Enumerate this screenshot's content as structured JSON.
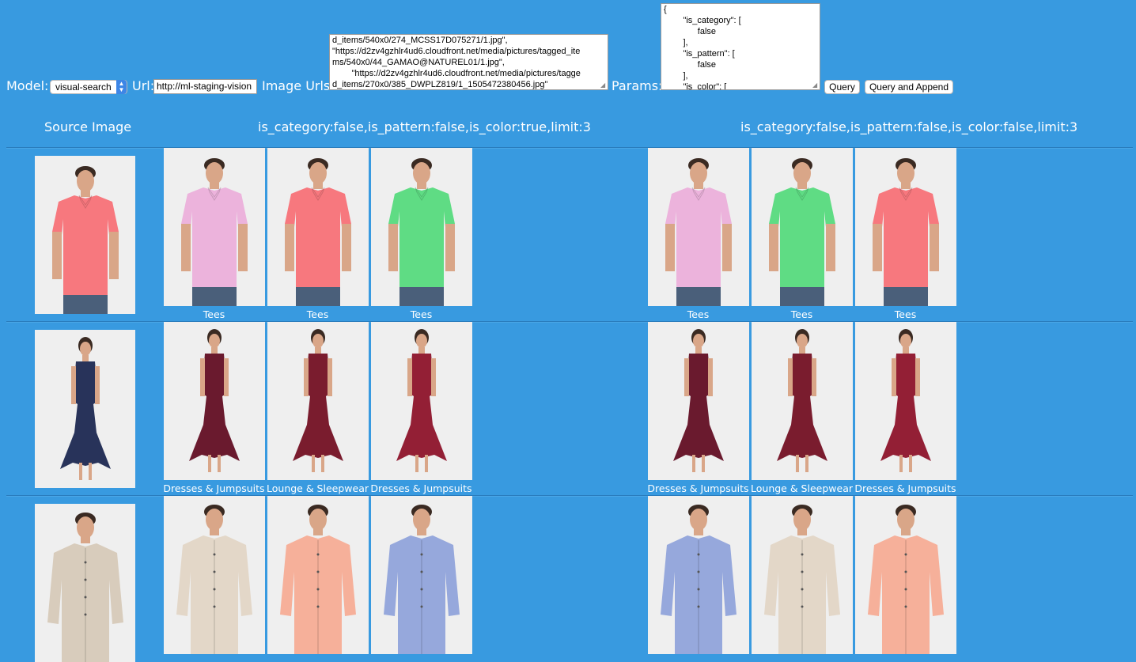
{
  "toolbar": {
    "model_label": "Model:",
    "model_value": "visual-search",
    "url_label": "Url:",
    "url_value": "http://ml-staging-vision",
    "image_urls_label": "Image Urls:",
    "image_urls_value": "d_items/540x0/274_MCSS17D075271/1.jpg\",\n\"https://d2zv4gzhlr4ud6.cloudfront.net/media/pictures/tagged_ite\nms/540x0/44_GAMAO@NATUREL01/1.jpg\",\n        \"https://d2zv4gzhlr4ud6.cloudfront.net/media/pictures/tagge\nd_items/270x0/385_DWPLZ819/1_1505472380456.jpg\"",
    "params_label": "Params:",
    "params_value": "{\n        \"is_category\": [\n              false\n        ],\n        \"is_pattern\": [\n              false\n        ],\n        \"is_color\": [",
    "query_button": "Query",
    "query_append_button": "Query and Append"
  },
  "headers": {
    "source": "Source Image",
    "col1": "is_category:false,is_pattern:false,is_color:true,limit:3",
    "col2": "is_category:false,is_pattern:false,is_color:false,limit:3"
  },
  "rows": [
    {
      "source": {
        "type": "tee",
        "color": "#f7787e"
      },
      "col1": [
        {
          "type": "tee",
          "color": "#ecb3dc",
          "label": "Tees"
        },
        {
          "type": "tee",
          "color": "#f7787e",
          "label": "Tees"
        },
        {
          "type": "tee",
          "color": "#5fdc84",
          "label": "Tees"
        }
      ],
      "col2": [
        {
          "type": "tee",
          "color": "#ecb3dc",
          "label": "Tees"
        },
        {
          "type": "tee",
          "color": "#5fdc84",
          "label": "Tees"
        },
        {
          "type": "tee",
          "color": "#f7787e",
          "label": "Tees"
        }
      ]
    },
    {
      "source": {
        "type": "dress",
        "color": "#28335a"
      },
      "col1": [
        {
          "type": "dress",
          "color": "#6a1a2e",
          "label": "Dresses & Jumpsuits"
        },
        {
          "type": "dress",
          "color": "#7a1c2e",
          "label": "Lounge & Sleepwear"
        },
        {
          "type": "dress",
          "color": "#931f35",
          "label": "Dresses & Jumpsuits"
        }
      ],
      "col2": [
        {
          "type": "dress",
          "color": "#6a1a2e",
          "label": "Dresses & Jumpsuits"
        },
        {
          "type": "dress",
          "color": "#7a1c2e",
          "label": "Lounge & Sleepwear"
        },
        {
          "type": "dress",
          "color": "#931f35",
          "label": "Dresses & Jumpsuits"
        }
      ]
    },
    {
      "source": {
        "type": "shirt",
        "color": "#d8ccbc"
      },
      "col1": [
        {
          "type": "shirt",
          "color": "#e3d7c8",
          "label": ""
        },
        {
          "type": "shirt",
          "color": "#f6b09a",
          "label": ""
        },
        {
          "type": "shirt",
          "color": "#96a8dc",
          "label": ""
        }
      ],
      "col2": [
        {
          "type": "shirt",
          "color": "#96a8dc",
          "label": ""
        },
        {
          "type": "shirt",
          "color": "#e3d7c8",
          "label": ""
        },
        {
          "type": "shirt",
          "color": "#f6b09a",
          "label": ""
        }
      ]
    }
  ]
}
